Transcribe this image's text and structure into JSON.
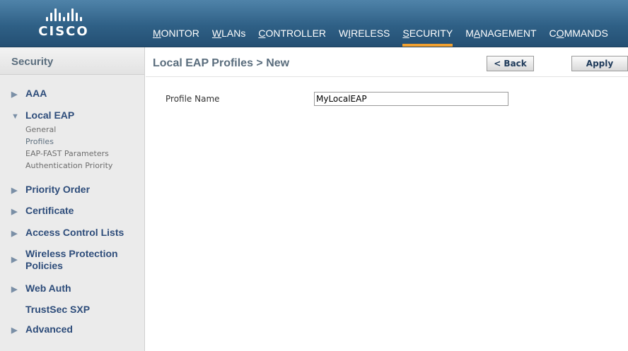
{
  "header": {
    "logo_text": "CISCO",
    "nav": [
      {
        "pre": "",
        "u": "M",
        "post": "ONITOR"
      },
      {
        "pre": "",
        "u": "W",
        "post": "LANs"
      },
      {
        "pre": "",
        "u": "C",
        "post": "ONTROLLER"
      },
      {
        "pre": "W",
        "u": "I",
        "post": "RELESS"
      },
      {
        "pre": "",
        "u": "S",
        "post": "ECURITY"
      },
      {
        "pre": "M",
        "u": "A",
        "post": "NAGEMENT"
      },
      {
        "pre": "C",
        "u": "O",
        "post": "MMANDS"
      }
    ]
  },
  "sidebar": {
    "title": "Security",
    "items": [
      {
        "label": "AAA"
      },
      {
        "label": "Local EAP"
      },
      {
        "label": "Priority Order"
      },
      {
        "label": "Certificate"
      },
      {
        "label": "Access Control Lists"
      },
      {
        "label": "Wireless Protection",
        "label2": "Policies"
      },
      {
        "label": "Web Auth"
      },
      {
        "label": "TrustSec SXP"
      },
      {
        "label": "Advanced"
      }
    ],
    "local_eap_sub": [
      "General",
      "Profiles",
      "EAP-FAST Parameters",
      "Authentication Priority"
    ]
  },
  "main": {
    "title": "Local EAP Profiles > New",
    "back_label": "< Back",
    "apply_label": "Apply",
    "profile_name_label": "Profile Name",
    "profile_name_value": "MyLocalEAP"
  },
  "icons": {
    "collapsed_arrow": "triangle-right-icon",
    "expanded_arrow": "triangle-down-icon"
  }
}
